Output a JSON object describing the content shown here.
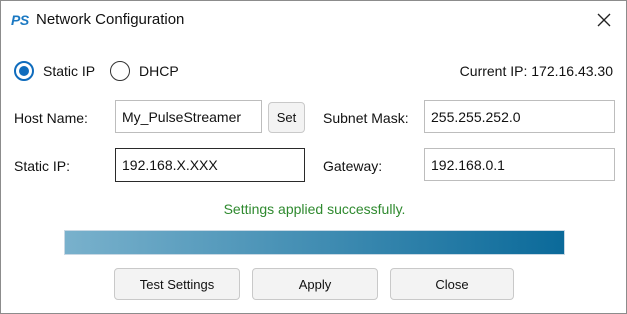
{
  "window": {
    "logo_text": "PS",
    "title": "Network Configuration"
  },
  "mode": {
    "options": [
      {
        "label": "Static IP",
        "selected": true
      },
      {
        "label": "DHCP",
        "selected": false
      }
    ]
  },
  "current_ip": "Current IP: 172.16.43.30",
  "form": {
    "host_name_label": "Host Name:",
    "host_name_value": "My_PulseStreamer",
    "set_label": "Set",
    "static_ip_label": "Static IP:",
    "static_ip_value": "192.168.X.XXX",
    "subnet_mask_label": "Subnet Mask:",
    "subnet_mask_value": "255.255.252.0",
    "gateway_label": "Gateway:",
    "gateway_value": "192.168.0.1"
  },
  "status_text": "Settings applied successfully.",
  "progress": {
    "value": 1.0
  },
  "colors": {
    "accent": "#0f6cbd",
    "status": "#2f8a2f",
    "progress_start": "#79b1cc",
    "progress_end": "#0b6a9a"
  },
  "buttons": {
    "test_settings": "Test Settings",
    "apply": "Apply",
    "close": "Close"
  },
  "icons": {
    "close": "close-icon"
  }
}
